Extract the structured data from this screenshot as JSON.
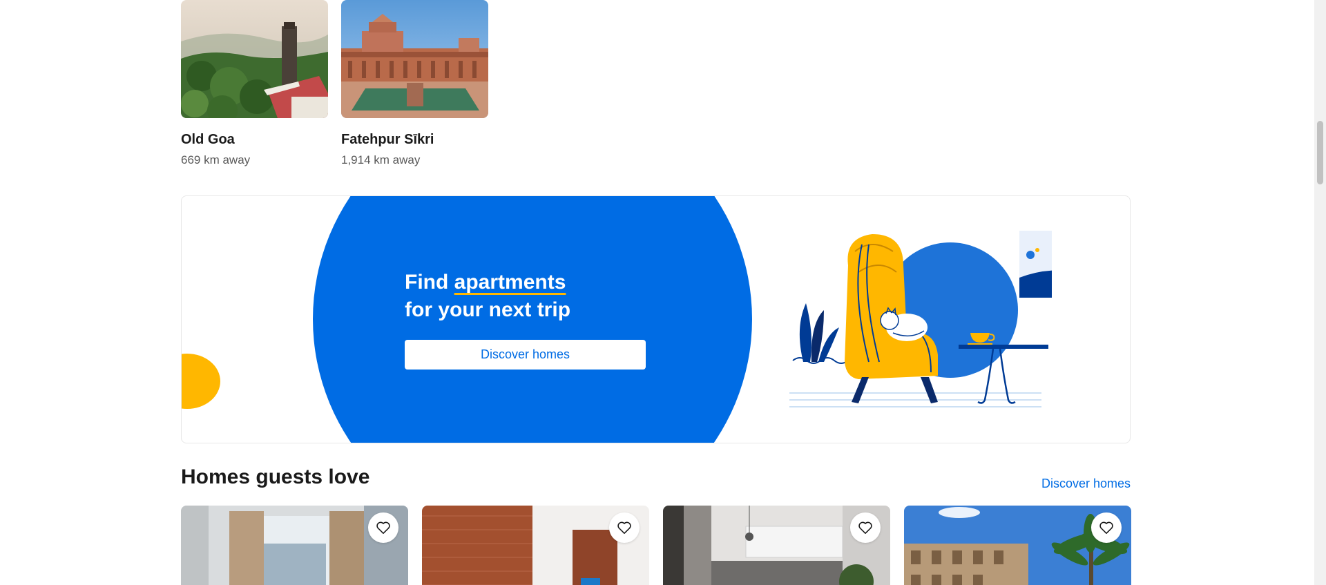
{
  "destinations": [
    {
      "name": "Old Goa",
      "distance": "669 km away"
    },
    {
      "name": "Fatehpur Sīkri",
      "distance": "1,914 km away"
    }
  ],
  "banner": {
    "title_prefix": "Find ",
    "title_highlight": "apartments",
    "title_line2": "for your next trip",
    "button_label": "Discover homes",
    "colors": {
      "primary": "#006ce4",
      "accent": "#ffb700"
    }
  },
  "homes_section": {
    "title": "Homes guests love",
    "link_label": "Discover homes"
  },
  "icons": {
    "favorite": "heart-icon"
  }
}
